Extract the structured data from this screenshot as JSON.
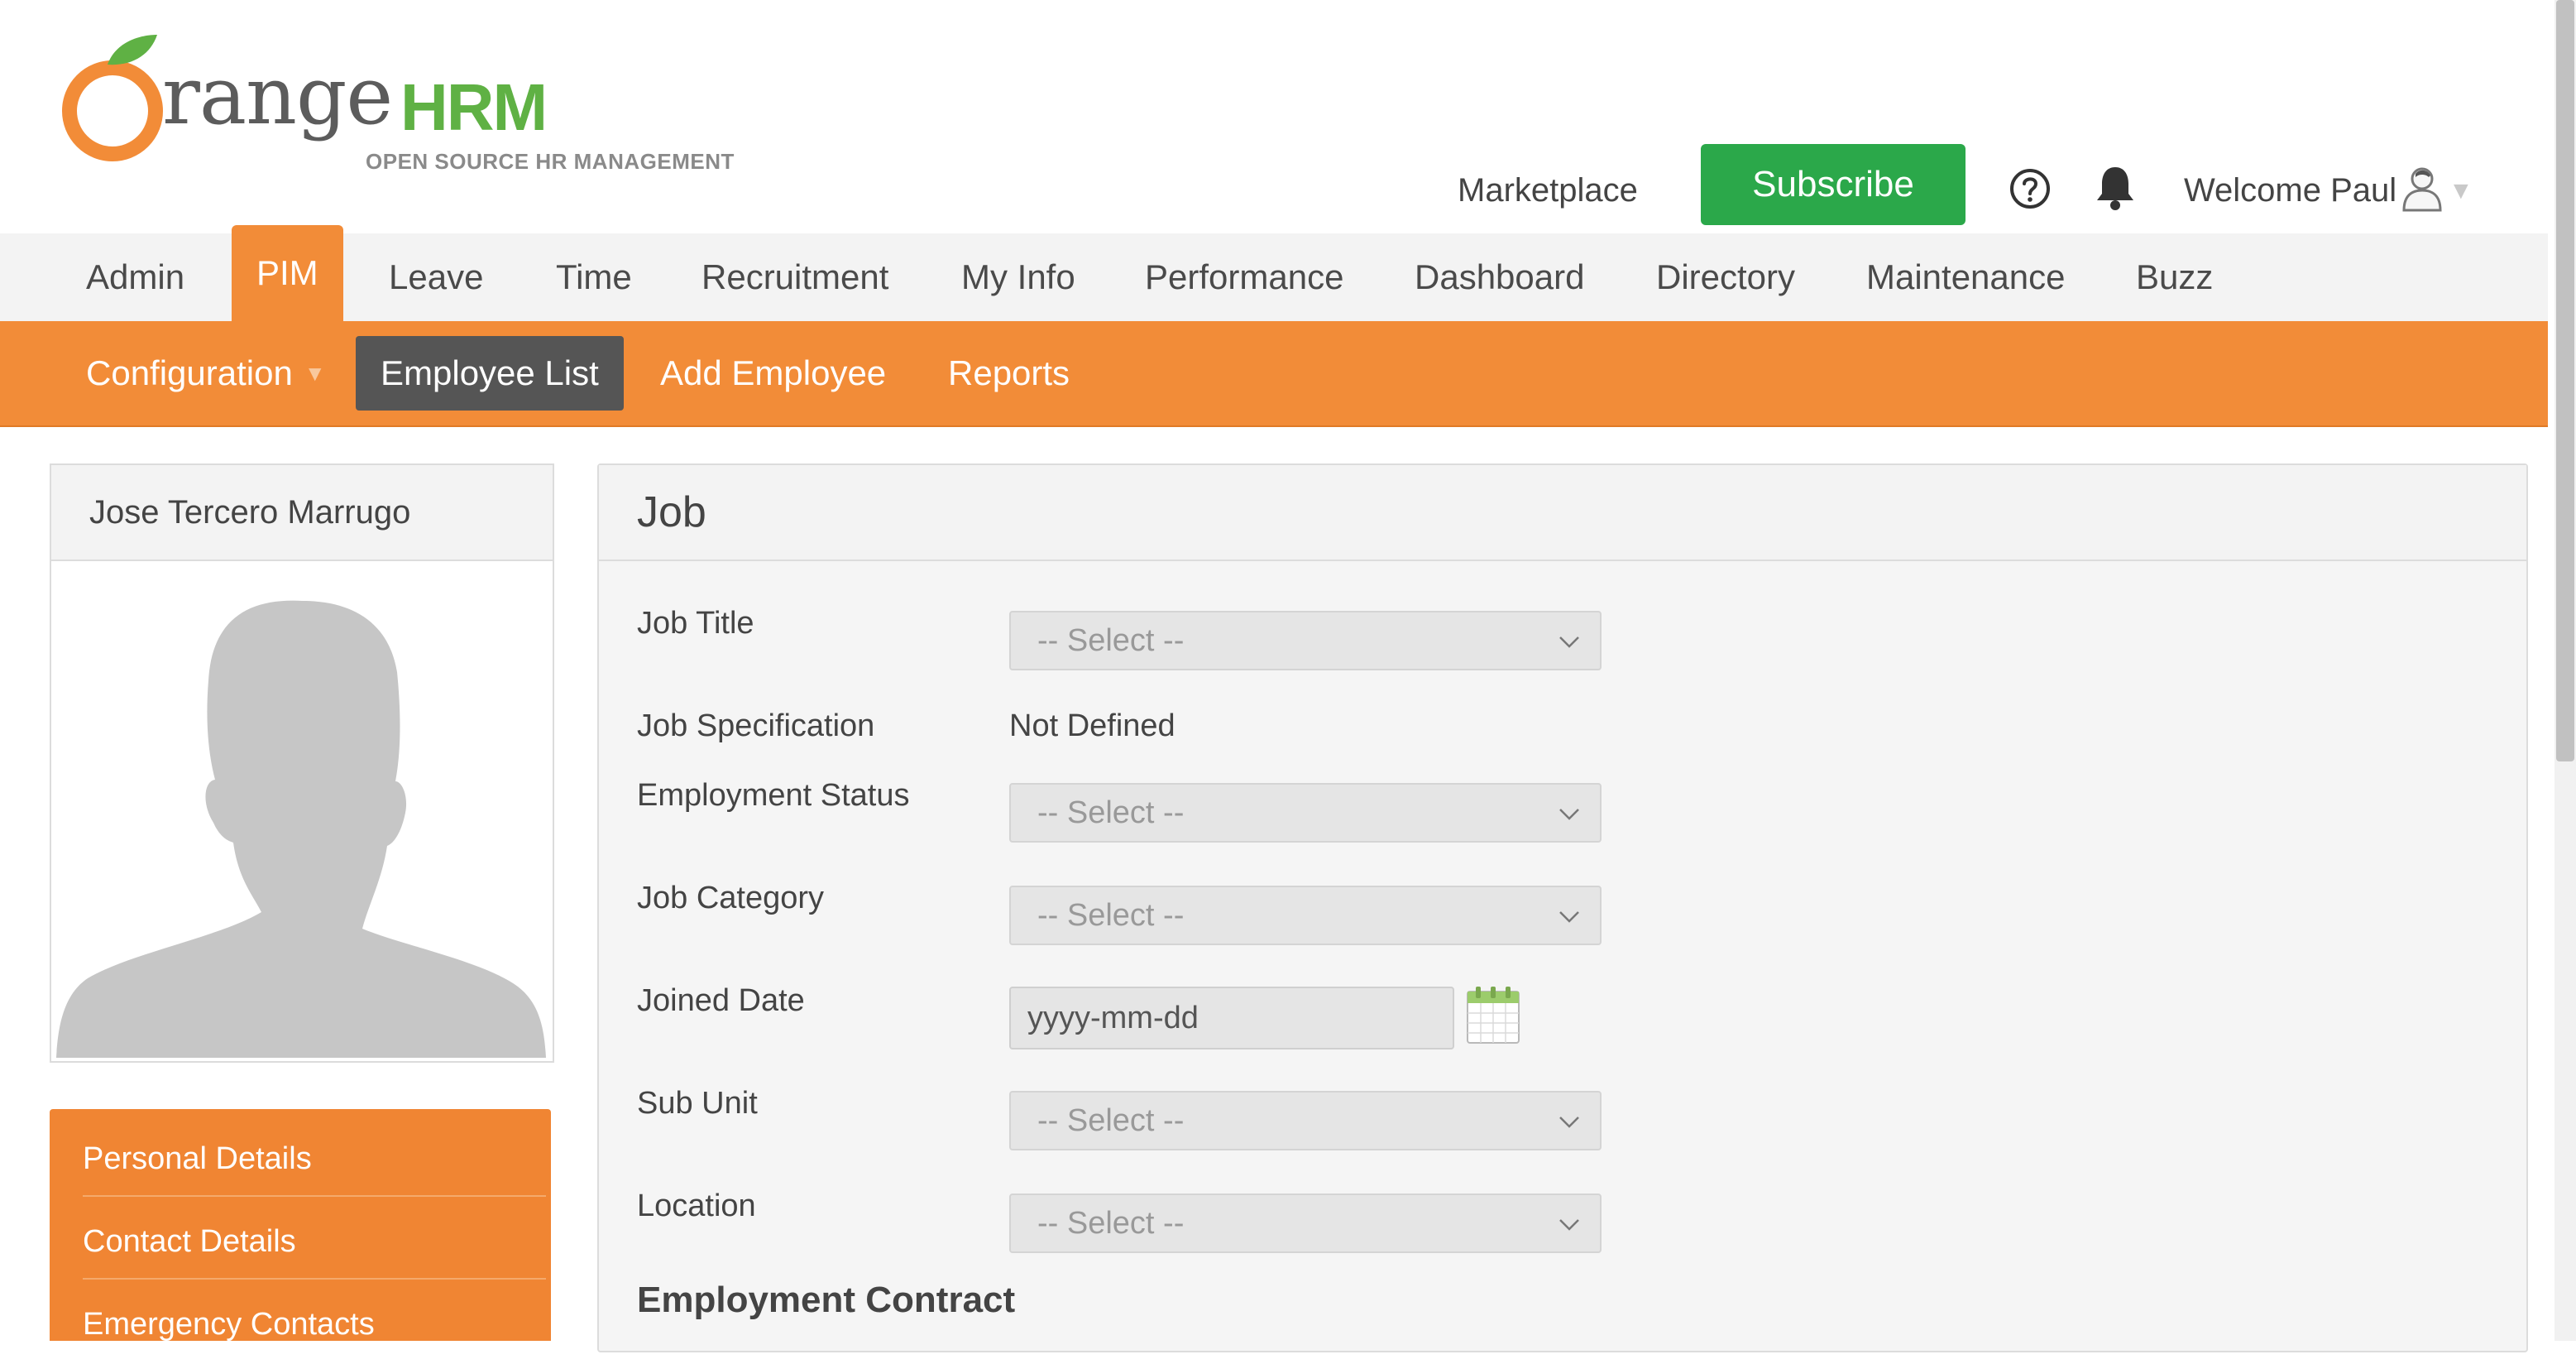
{
  "logo": {
    "brand_first": "O",
    "brand_rest": "range",
    "brand_suffix": "HRM",
    "tagline": "OPEN SOURCE HR MANAGEMENT"
  },
  "header": {
    "marketplace": "Marketplace",
    "subscribe": "Subscribe",
    "welcome": "Welcome Paul"
  },
  "main_nav": [
    "Admin",
    "PIM",
    "Leave",
    "Time",
    "Recruitment",
    "My Info",
    "Performance",
    "Dashboard",
    "Directory",
    "Maintenance",
    "Buzz"
  ],
  "main_nav_active": "PIM",
  "sub_nav": {
    "configuration": "Configuration",
    "employee_list": "Employee List",
    "add_employee": "Add Employee",
    "reports": "Reports"
  },
  "profile": {
    "name": "Jose Tercero Marrugo"
  },
  "side_menu": [
    "Personal Details",
    "Contact Details",
    "Emergency Contacts"
  ],
  "job": {
    "title": "Job",
    "fields": {
      "job_title": {
        "label": "Job Title",
        "value": "-- Select --"
      },
      "job_spec": {
        "label": "Job Specification",
        "value": "Not Defined"
      },
      "employment_status": {
        "label": "Employment Status",
        "value": "-- Select --"
      },
      "job_category": {
        "label": "Job Category",
        "value": "-- Select --"
      },
      "joined_date": {
        "label": "Joined Date",
        "placeholder": "yyyy-mm-dd"
      },
      "sub_unit": {
        "label": "Sub Unit",
        "value": "-- Select --"
      },
      "location": {
        "label": "Location",
        "value": "-- Select --"
      }
    },
    "contract_title": "Employment Contract"
  },
  "colors": {
    "orange": "#f28c38",
    "green": "#2ba84a",
    "dark_tab": "#555555"
  }
}
